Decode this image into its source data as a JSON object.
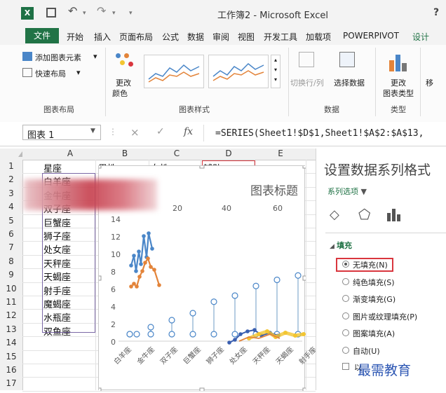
{
  "titlebar": {
    "app_icon": "excel-icon",
    "save_icon": "save-icon",
    "undo_icon": "undo-icon",
    "redo_icon": "redo-icon",
    "title": "工作簿2 - Microsoft Excel",
    "help": "?"
  },
  "ribbon_tabs": [
    "文件",
    "开始",
    "插入",
    "页面布局",
    "公式",
    "数据",
    "审阅",
    "视图",
    "开发工具",
    "加载项",
    "POWERPIVOT",
    "设计"
  ],
  "ribbon": {
    "add_element": "添加图表元素",
    "quick_layout": "快速布局",
    "change_colors_1": "更改",
    "change_colors_2": "颜色",
    "switch_row_col": "切换行/列",
    "select_data": "选择数据",
    "change_type_1": "更改",
    "change_type_2": "图表类型",
    "move": "移",
    "groups": {
      "layout": "图表布局",
      "styles": "图表样式",
      "data": "数据",
      "type": "类型"
    }
  },
  "formula_bar": {
    "name_box": "图表 1",
    "cancel": "×",
    "enter": "✓",
    "fx": "fx",
    "formula": "=SERIES(Sheet1!$D$1,Sheet1!$A$2:$A$13,"
  },
  "sheet": {
    "columns": [
      "A",
      "B",
      "C",
      "D",
      "E"
    ],
    "rows": [
      "1",
      "2",
      "3",
      "4",
      "5",
      "6",
      "7",
      "8",
      "9",
      "10",
      "11",
      "12",
      "13",
      "14",
      "15",
      "16",
      "17"
    ],
    "row1": [
      "星座",
      "男性",
      "女性",
      "辅助"
    ],
    "col_a": [
      "白羊座",
      "金牛座",
      "双子座",
      "巨蟹座",
      "狮子座",
      "处女座",
      "天秤座",
      "天蝎座",
      "射手座",
      "魔蝎座",
      "水瓶座",
      "双鱼座"
    ]
  },
  "chart": {
    "title": "图表标题",
    "top_ticks": [
      "20",
      "40",
      "60"
    ],
    "y_ticks": [
      "14",
      "12",
      "10",
      "8",
      "6",
      "4",
      "2",
      "0"
    ],
    "x_labels": [
      "白羊座",
      "金牛座",
      "双子座",
      "巨蟹座",
      "狮子座",
      "处女座",
      "天秤座",
      "天蝎座",
      "射手座"
    ]
  },
  "pane": {
    "title": "设置数据系列格式",
    "series_options": "系列选项",
    "section": "填充",
    "options": [
      "无填充(N)",
      "纯色填充(S)",
      "渐变填充(G)",
      "图片或纹理填充(P)",
      "图案填充(A)",
      "自动(U)"
    ],
    "selected": "无填充(N)",
    "last_partial": "以"
  },
  "watermark": "最需教育",
  "colors": {
    "excel_green": "#217346",
    "series_blue": "#4a86c8",
    "series_orange": "#e3843a",
    "series_yellow": "#f2c531",
    "range_purple": "#7b68a6",
    "highlight_red": "#d9363e"
  }
}
